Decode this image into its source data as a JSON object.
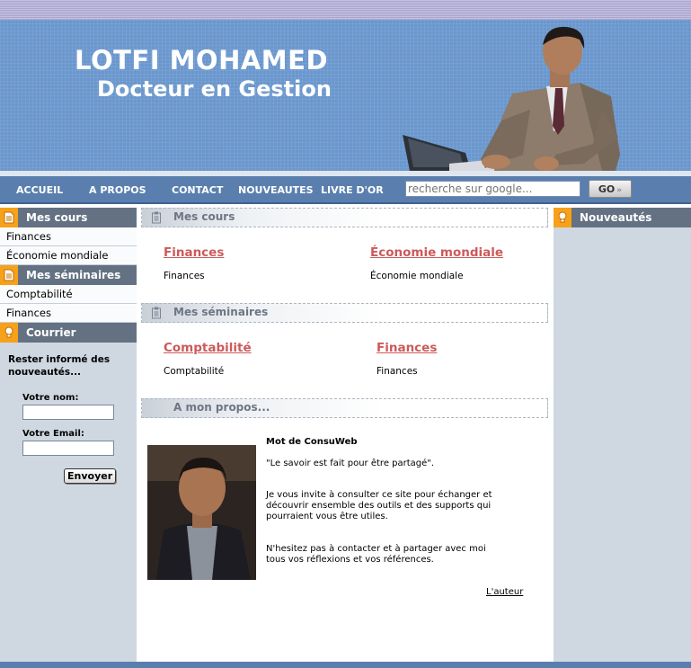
{
  "header": {
    "title": "LOTFI MOHAMED",
    "subtitle": "Docteur en Gestion"
  },
  "nav": {
    "items": [
      "ACCUEIL",
      "A PROPOS",
      "CONTACT",
      "NOUVEAUTES",
      "LIVRE D'OR"
    ],
    "search_placeholder": "recherche sur google...",
    "go_label": "GO"
  },
  "sidebar_left": {
    "courses_heading": "Mes cours",
    "courses": [
      "Finances",
      "Économie mondiale"
    ],
    "seminars_heading": "Mes séminaires",
    "seminars": [
      "Comptabilité",
      "Finances"
    ],
    "mail_heading": "Courrier",
    "newsletter": {
      "intro": "Rester informé des nouveautés...",
      "name_label": "Votre nom:",
      "email_label": "Votre Email:",
      "send_label": "Envoyer"
    }
  },
  "main": {
    "courses_section": "Mes cours",
    "courses": [
      {
        "title": "Finances",
        "desc": "Finances"
      },
      {
        "title": "Économie mondiale",
        "desc": "Économie mondiale"
      }
    ],
    "seminars_section": "Mes séminaires",
    "seminars": [
      {
        "title": "Comptabilité",
        "desc": "Comptabilité"
      },
      {
        "title": "Finances",
        "desc": "Finances"
      }
    ],
    "about_section": "A mon propos...",
    "about": {
      "heading": "Mot de ConsuWeb",
      "quote": "\"Le savoir est fait pour être partagé\".",
      "p1_line1": "Je vous invite à consulter ce site pour échanger et",
      "p1_line2": "découvrir ensemble des outils et des supports qui",
      "p1_line3": "pourraient vous être utiles.",
      "p2_line1": "N'hesitez pas à contacter et à partager avec moi",
      "p2_line2": "tous vos réflexions et vos références.",
      "author_link": "L'auteur"
    }
  },
  "sidebar_right": {
    "news_heading": "Nouveautés"
  },
  "colors": {
    "header_blue": "#6a97cd",
    "nav_blue": "#5a7fae",
    "sidebar_bg": "#cfd8e1",
    "heading_gray": "#637183",
    "accent_orange": "#f7a11a",
    "link_red": "#cc5a5a"
  },
  "icons": {
    "courses": "document-icon",
    "seminars": "document-icon",
    "mail": "lightbulb-icon",
    "news": "lightbulb-icon",
    "section": "clipboard-icon"
  }
}
